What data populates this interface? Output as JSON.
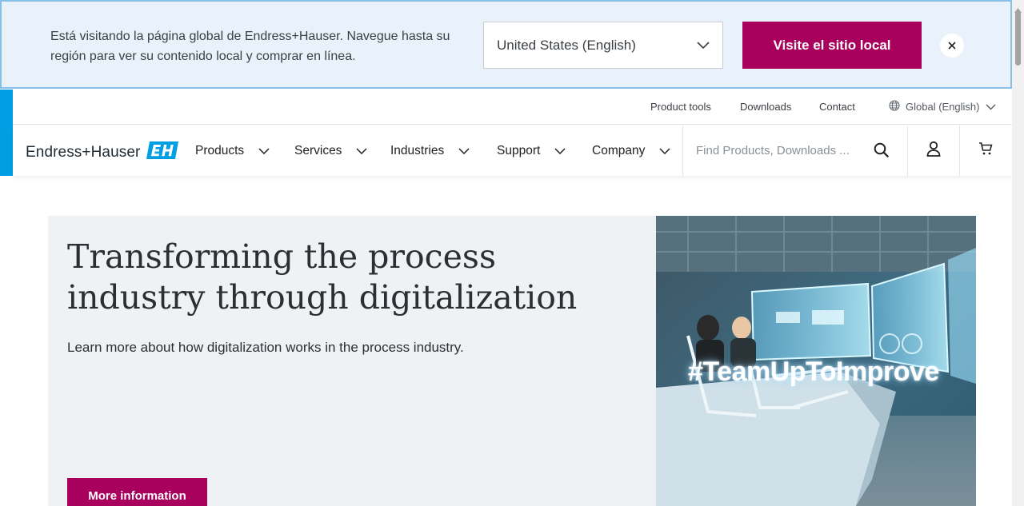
{
  "region_banner": {
    "message": "Está visitando la página global de Endress+Hauser. Navegue hasta su región para ver su contenido local y comprar en línea.",
    "selected_region": "United States (English)",
    "visit_button": "Visite el sitio local",
    "close_icon": "close-icon"
  },
  "utility_bar": {
    "links": [
      "Product tools",
      "Downloads",
      "Contact"
    ],
    "language": "Global (English)",
    "language_icon": "globe-icon"
  },
  "nav": {
    "logo_text": "Endress+Hauser",
    "items": [
      "Products",
      "Services",
      "Industries",
      "Support",
      "Company"
    ],
    "search_placeholder": "Find Products, Downloads ...",
    "icons": [
      "search-icon",
      "user-icon",
      "cart-icon"
    ]
  },
  "hero": {
    "title": "Transforming the process industry through digitalization",
    "subtitle": "Learn more about how digitalization works in the process industry.",
    "cta": "More information",
    "image_tag": "#TeamUpToImprove"
  },
  "colors": {
    "brand_magenta": "#a8005c",
    "brand_blue": "#009fe3",
    "banner_bg": "#e9f2fa",
    "hero_bg": "#eff2f4"
  }
}
